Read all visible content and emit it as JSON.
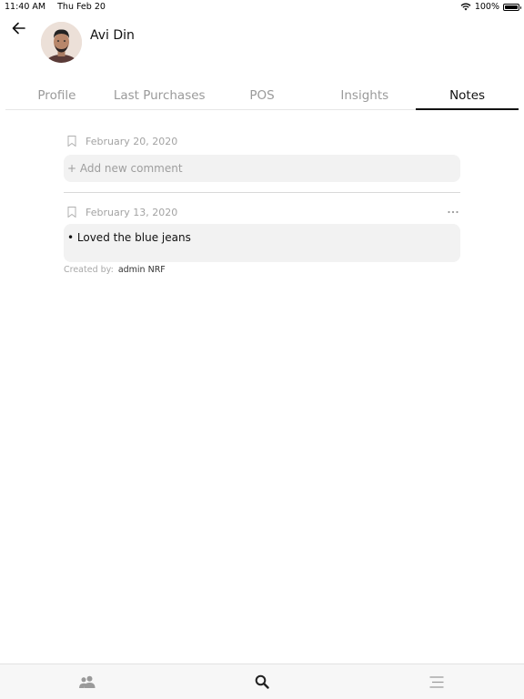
{
  "status_bar": {
    "time": "11:40 AM",
    "date": "Thu Feb 20",
    "battery_percent": "100%",
    "battery_level": 1.0,
    "icons": [
      "wifi-icon",
      "battery-icon"
    ]
  },
  "header": {
    "back_icon": "arrow-left-icon",
    "customer_name": "Avi Din"
  },
  "tabs": [
    {
      "label": "Profile",
      "active": false
    },
    {
      "label": "Last Purchases",
      "active": false
    },
    {
      "label": "POS",
      "active": false
    },
    {
      "label": "Insights",
      "active": false
    },
    {
      "label": "Notes",
      "active": true
    }
  ],
  "new_note": {
    "date": "February 20, 2020",
    "placeholder": "+ Add new comment",
    "icon": "bookmark-icon"
  },
  "notes": [
    {
      "date": "February 13, 2020",
      "text": "• Loved the blue jeans",
      "created_by_label": "Created by:",
      "author": "admin NRF",
      "more_icon": "ellipsis-icon"
    }
  ],
  "bottom_nav": [
    {
      "icon": "people-icon",
      "active": false
    },
    {
      "icon": "search-icon",
      "active": true
    },
    {
      "icon": "menu-icon",
      "active": false
    }
  ],
  "colors": {
    "muted_text": "#a3a3a3",
    "input_background": "#f2f2f2",
    "active_tab": "#111111"
  }
}
